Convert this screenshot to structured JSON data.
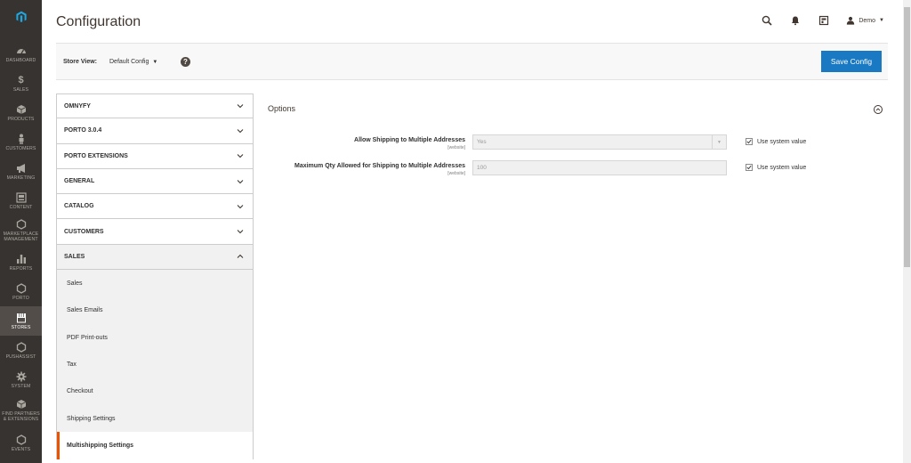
{
  "nav": {
    "items": [
      {
        "label": "DASHBOARD",
        "icon": "dashboard-icon"
      },
      {
        "label": "SALES",
        "icon": "dollar-icon"
      },
      {
        "label": "PRODUCTS",
        "icon": "cube-icon"
      },
      {
        "label": "CUSTOMERS",
        "icon": "person-icon"
      },
      {
        "label": "MARKETING",
        "icon": "megaphone-icon"
      },
      {
        "label": "CONTENT",
        "icon": "content-icon"
      },
      {
        "label": "MARKETPLACE MANAGEMENT",
        "icon": "hexagon-icon"
      },
      {
        "label": "REPORTS",
        "icon": "bar-chart-icon"
      },
      {
        "label": "PORTO",
        "icon": "hexagon-icon"
      },
      {
        "label": "STORES",
        "icon": "store-icon"
      },
      {
        "label": "PUSHASSIST",
        "icon": "hexagon-icon"
      },
      {
        "label": "SYSTEM",
        "icon": "gear-icon"
      },
      {
        "label": "FIND PARTNERS & EXTENSIONS",
        "icon": "box-icon"
      },
      {
        "label": "EVENTS",
        "icon": "hexagon-icon"
      }
    ],
    "active": "STORES"
  },
  "header": {
    "title": "Configuration",
    "user": "Demo"
  },
  "store_bar": {
    "label": "Store View:",
    "value": "Default Config",
    "help": "?",
    "save_label": "Save Config"
  },
  "tabs": {
    "sections": [
      "OMNYFY",
      "PORTO 3.0.4",
      "PORTO EXTENSIONS",
      "GENERAL",
      "CATALOG",
      "CUSTOMERS",
      "SALES"
    ],
    "sales_items": [
      "Sales",
      "Sales Emails",
      "PDF Print-outs",
      "Tax",
      "Checkout",
      "Shipping Settings",
      "Multishipping Settings"
    ],
    "active_item": "Multishipping Settings"
  },
  "options": {
    "title": "Options",
    "rows": [
      {
        "label": "Allow Shipping to Multiple Addresses",
        "scope": "[website]",
        "value": "Yes",
        "use_system": "Use system value"
      },
      {
        "label": "Maximum Qty Allowed for Shipping to Multiple Addresses",
        "scope": "[website]",
        "value": "100",
        "use_system": "Use system value"
      }
    ]
  },
  "colors": {
    "nav_bg": "#373330",
    "accent": "#eb5202",
    "primary_button": "#1979c3"
  }
}
